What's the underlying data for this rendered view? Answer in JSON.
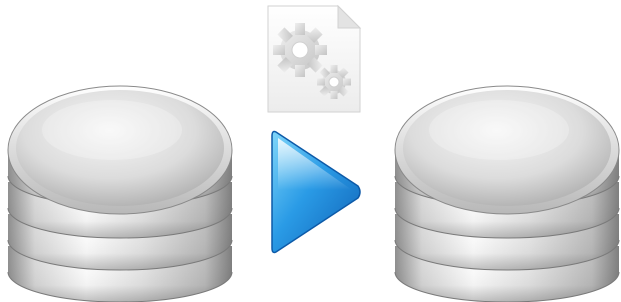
{
  "scene": {
    "background_color": "#ffffff",
    "source_database": {
      "icon": "database-icon",
      "disk_count": 4
    },
    "target_database": {
      "icon": "database-icon",
      "disk_count": 4
    },
    "config_document": {
      "icon": "config-file-gears-icon"
    },
    "transfer_arrow": {
      "icon": "play-arrow-icon",
      "color": "#1e88d8",
      "highlight_color": "#5cc4f4"
    },
    "disk_colors": {
      "top_face_light": "#f2f2f2",
      "top_face_dark": "#a9a9a9",
      "side_light": "#ffffff",
      "side_dark": "#8a8a8a"
    }
  }
}
